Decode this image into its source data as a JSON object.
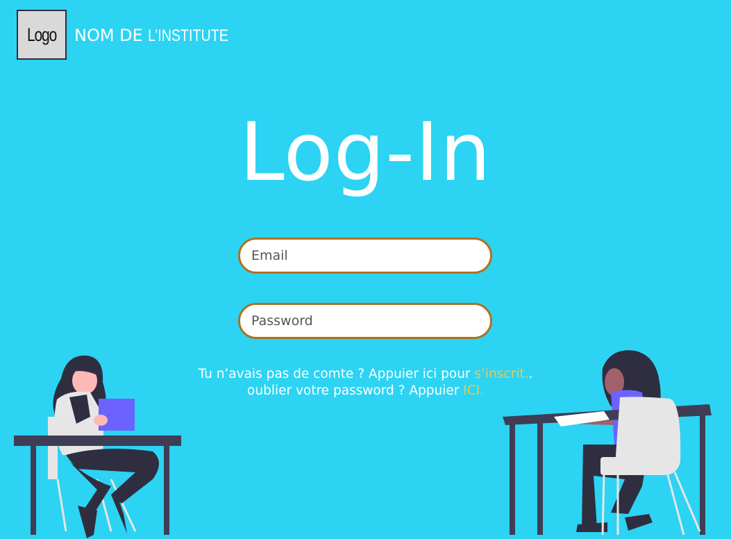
{
  "header": {
    "logo_text": "Logo",
    "institute_name_part1": "NOM DE",
    "institute_name_part2": "L’INSTITUTE"
  },
  "main": {
    "title": "Log-In",
    "email_placeholder": "Email",
    "password_placeholder": "Password"
  },
  "messages": {
    "signup_prefix": "Tu n’avais pas de comte ? Appuier ici pour ",
    "signup_link": "s’inscrit.",
    "signup_suffix": ".",
    "forgot_prefix": "oublier votre password ? Appuier ",
    "forgot_link": "ICI."
  },
  "colors": {
    "background": "#2cd3f3",
    "field_border": "#b0711c",
    "link": "#eec84e"
  }
}
